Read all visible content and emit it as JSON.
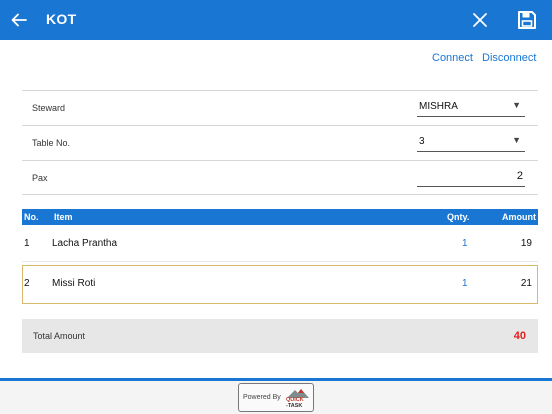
{
  "header": {
    "title": "KOT",
    "back_icon": "back-arrow-icon",
    "close_icon": "close-icon",
    "save_icon": "save-disk-icon"
  },
  "actions": {
    "connect_label": "Connect",
    "disconnect_label": "Disconnect"
  },
  "form": {
    "steward": {
      "label": "Steward",
      "value": "MISHRA"
    },
    "table_no": {
      "label": "Table No.",
      "value": "3"
    },
    "pax": {
      "label": "Pax",
      "value": "2"
    }
  },
  "table": {
    "columns": [
      "No.",
      "Item",
      "Qnty.",
      "Amount"
    ],
    "rows": [
      {
        "no": "1",
        "item": "Lacha Prantha",
        "qty": "1",
        "amount": "19"
      },
      {
        "no": "2",
        "item": "Missi Roti",
        "qty": "1",
        "amount": "21"
      }
    ]
  },
  "total": {
    "label": "Total Amount",
    "value": "40"
  },
  "footer": {
    "powered_by": "Powered By",
    "logo_line1": "QUICK",
    "logo_line2": "-TASK"
  },
  "colors": {
    "primary": "#1976d2",
    "total_value": "#e02020",
    "selected_row_border": "#d9b96b"
  }
}
